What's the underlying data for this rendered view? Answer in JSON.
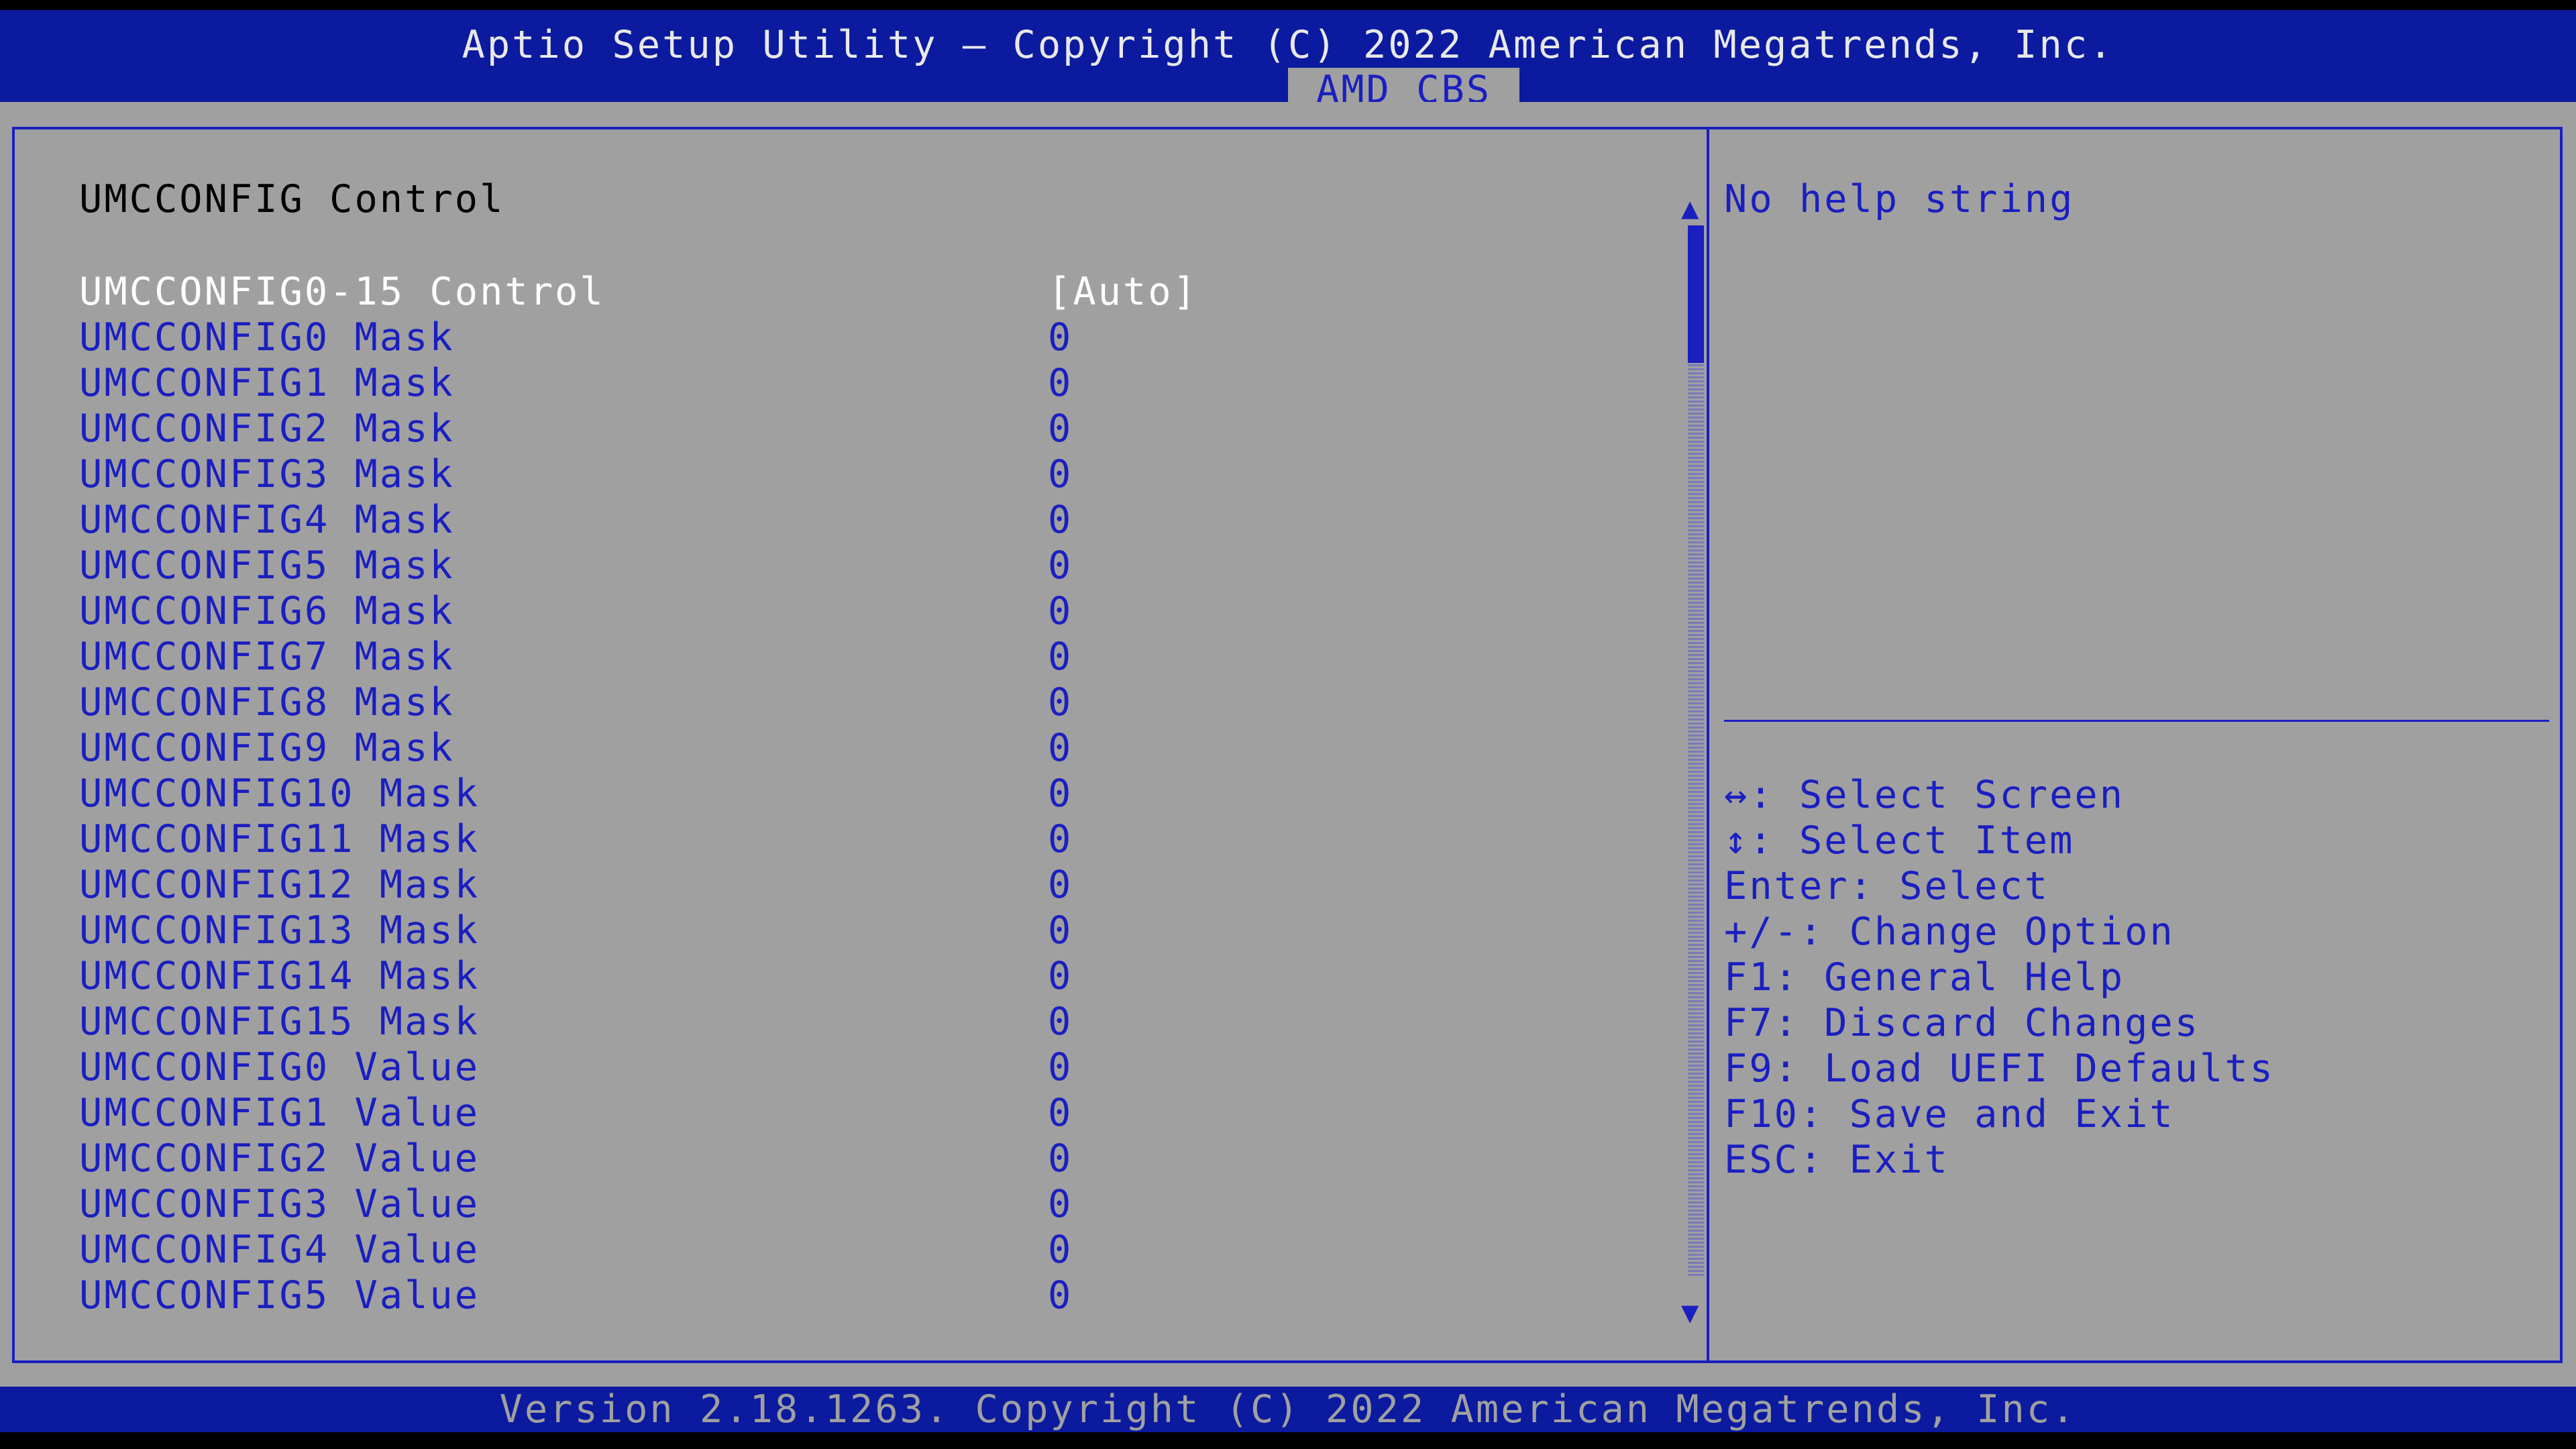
{
  "header": {
    "title": "Aptio Setup Utility – Copyright (C) 2022 American Megatrends, Inc.",
    "active_tab": "AMD CBS"
  },
  "main": {
    "section_title": "UMCCONFIG Control",
    "items": [
      {
        "label": "UMCCONFIG0-15 Control",
        "value": "[Auto]",
        "selected": true
      },
      {
        "label": "UMCCONFIG0 Mask",
        "value": "0"
      },
      {
        "label": "UMCCONFIG1 Mask",
        "value": "0"
      },
      {
        "label": "UMCCONFIG2 Mask",
        "value": "0"
      },
      {
        "label": "UMCCONFIG3 Mask",
        "value": "0"
      },
      {
        "label": "UMCCONFIG4 Mask",
        "value": "0"
      },
      {
        "label": "UMCCONFIG5 Mask",
        "value": "0"
      },
      {
        "label": "UMCCONFIG6 Mask",
        "value": "0"
      },
      {
        "label": "UMCCONFIG7 Mask",
        "value": "0"
      },
      {
        "label": "UMCCONFIG8 Mask",
        "value": "0"
      },
      {
        "label": "UMCCONFIG9 Mask",
        "value": "0"
      },
      {
        "label": "UMCCONFIG10 Mask",
        "value": "0"
      },
      {
        "label": "UMCCONFIG11 Mask",
        "value": "0"
      },
      {
        "label": "UMCCONFIG12 Mask",
        "value": "0"
      },
      {
        "label": "UMCCONFIG13 Mask",
        "value": "0"
      },
      {
        "label": "UMCCONFIG14 Mask",
        "value": "0"
      },
      {
        "label": "UMCCONFIG15 Mask",
        "value": "0"
      },
      {
        "label": "UMCCONFIG0 Value",
        "value": "0"
      },
      {
        "label": "UMCCONFIG1 Value",
        "value": "0"
      },
      {
        "label": "UMCCONFIG2 Value",
        "value": "0"
      },
      {
        "label": "UMCCONFIG3 Value",
        "value": "0"
      },
      {
        "label": "UMCCONFIG4 Value",
        "value": "0"
      },
      {
        "label": "UMCCONFIG5 Value",
        "value": "0"
      }
    ],
    "scroll_up_glyph": "▲",
    "scroll_down_glyph": "▼"
  },
  "help": {
    "text": "No help string",
    "keys": [
      "↔: Select Screen",
      "↕: Select Item",
      "Enter: Select",
      "+/-: Change Option",
      "F1: General Help",
      "F7: Discard Changes",
      "F9: Load UEFI Defaults",
      "F10: Save and Exit",
      "ESC: Exit"
    ]
  },
  "footer": {
    "version": "Version 2.18.1263. Copyright (C) 2022 American Megatrends, Inc."
  },
  "colors": {
    "bar_blue": "#0b1a9e",
    "panel_gray": "#a0a0a0",
    "text_blue": "#1a1fc0",
    "selected_white": "#ffffff"
  }
}
